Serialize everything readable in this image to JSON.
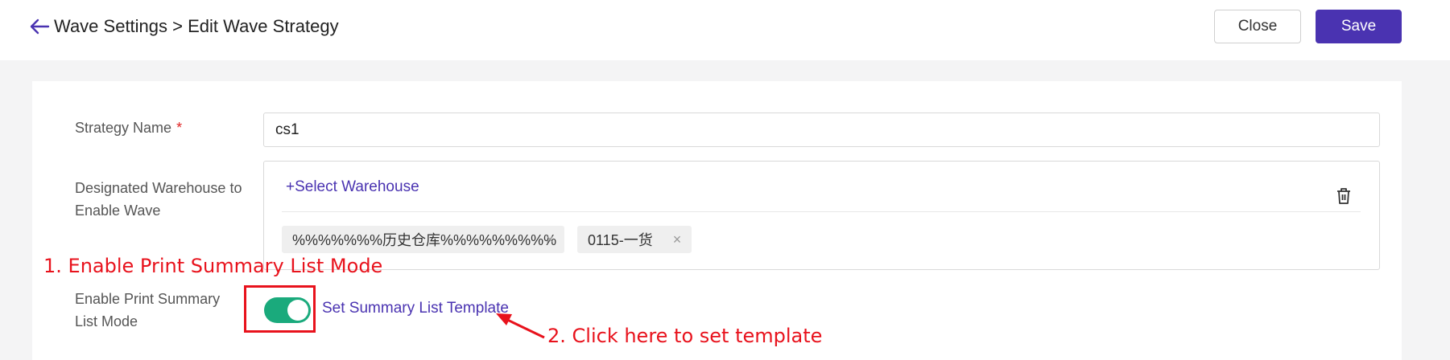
{
  "header": {
    "breadcrumb": "Wave Settings > Edit Wave Strategy",
    "close_label": "Close",
    "save_label": "Save"
  },
  "form": {
    "strategy_name": {
      "label": "Strategy Name",
      "required_mark": "*",
      "value": "cs1"
    },
    "warehouse": {
      "label": "Designated Warehouse to Enable Wave",
      "select_link": "+Select Warehouse",
      "tags": [
        {
          "label": "%%%%%%%历史仓库%%%%%%%%%",
          "close": "×"
        },
        {
          "label": "0115-一货",
          "close": "×"
        }
      ]
    },
    "print_summary": {
      "label": "Enable Print Summary List Mode",
      "enabled": true,
      "template_link": "Set Summary List Template"
    }
  },
  "annotations": {
    "step1": "1. Enable Print Summary List Mode",
    "step2": "2. Click here to set template"
  },
  "colors": {
    "accent": "#4a33b1",
    "toggle_on": "#1aaa7c",
    "annotation": "#e8121c",
    "required": "#e02424"
  },
  "icons": {
    "back": "arrow-left-icon",
    "delete": "trash-icon",
    "tag_close": "close-icon"
  }
}
